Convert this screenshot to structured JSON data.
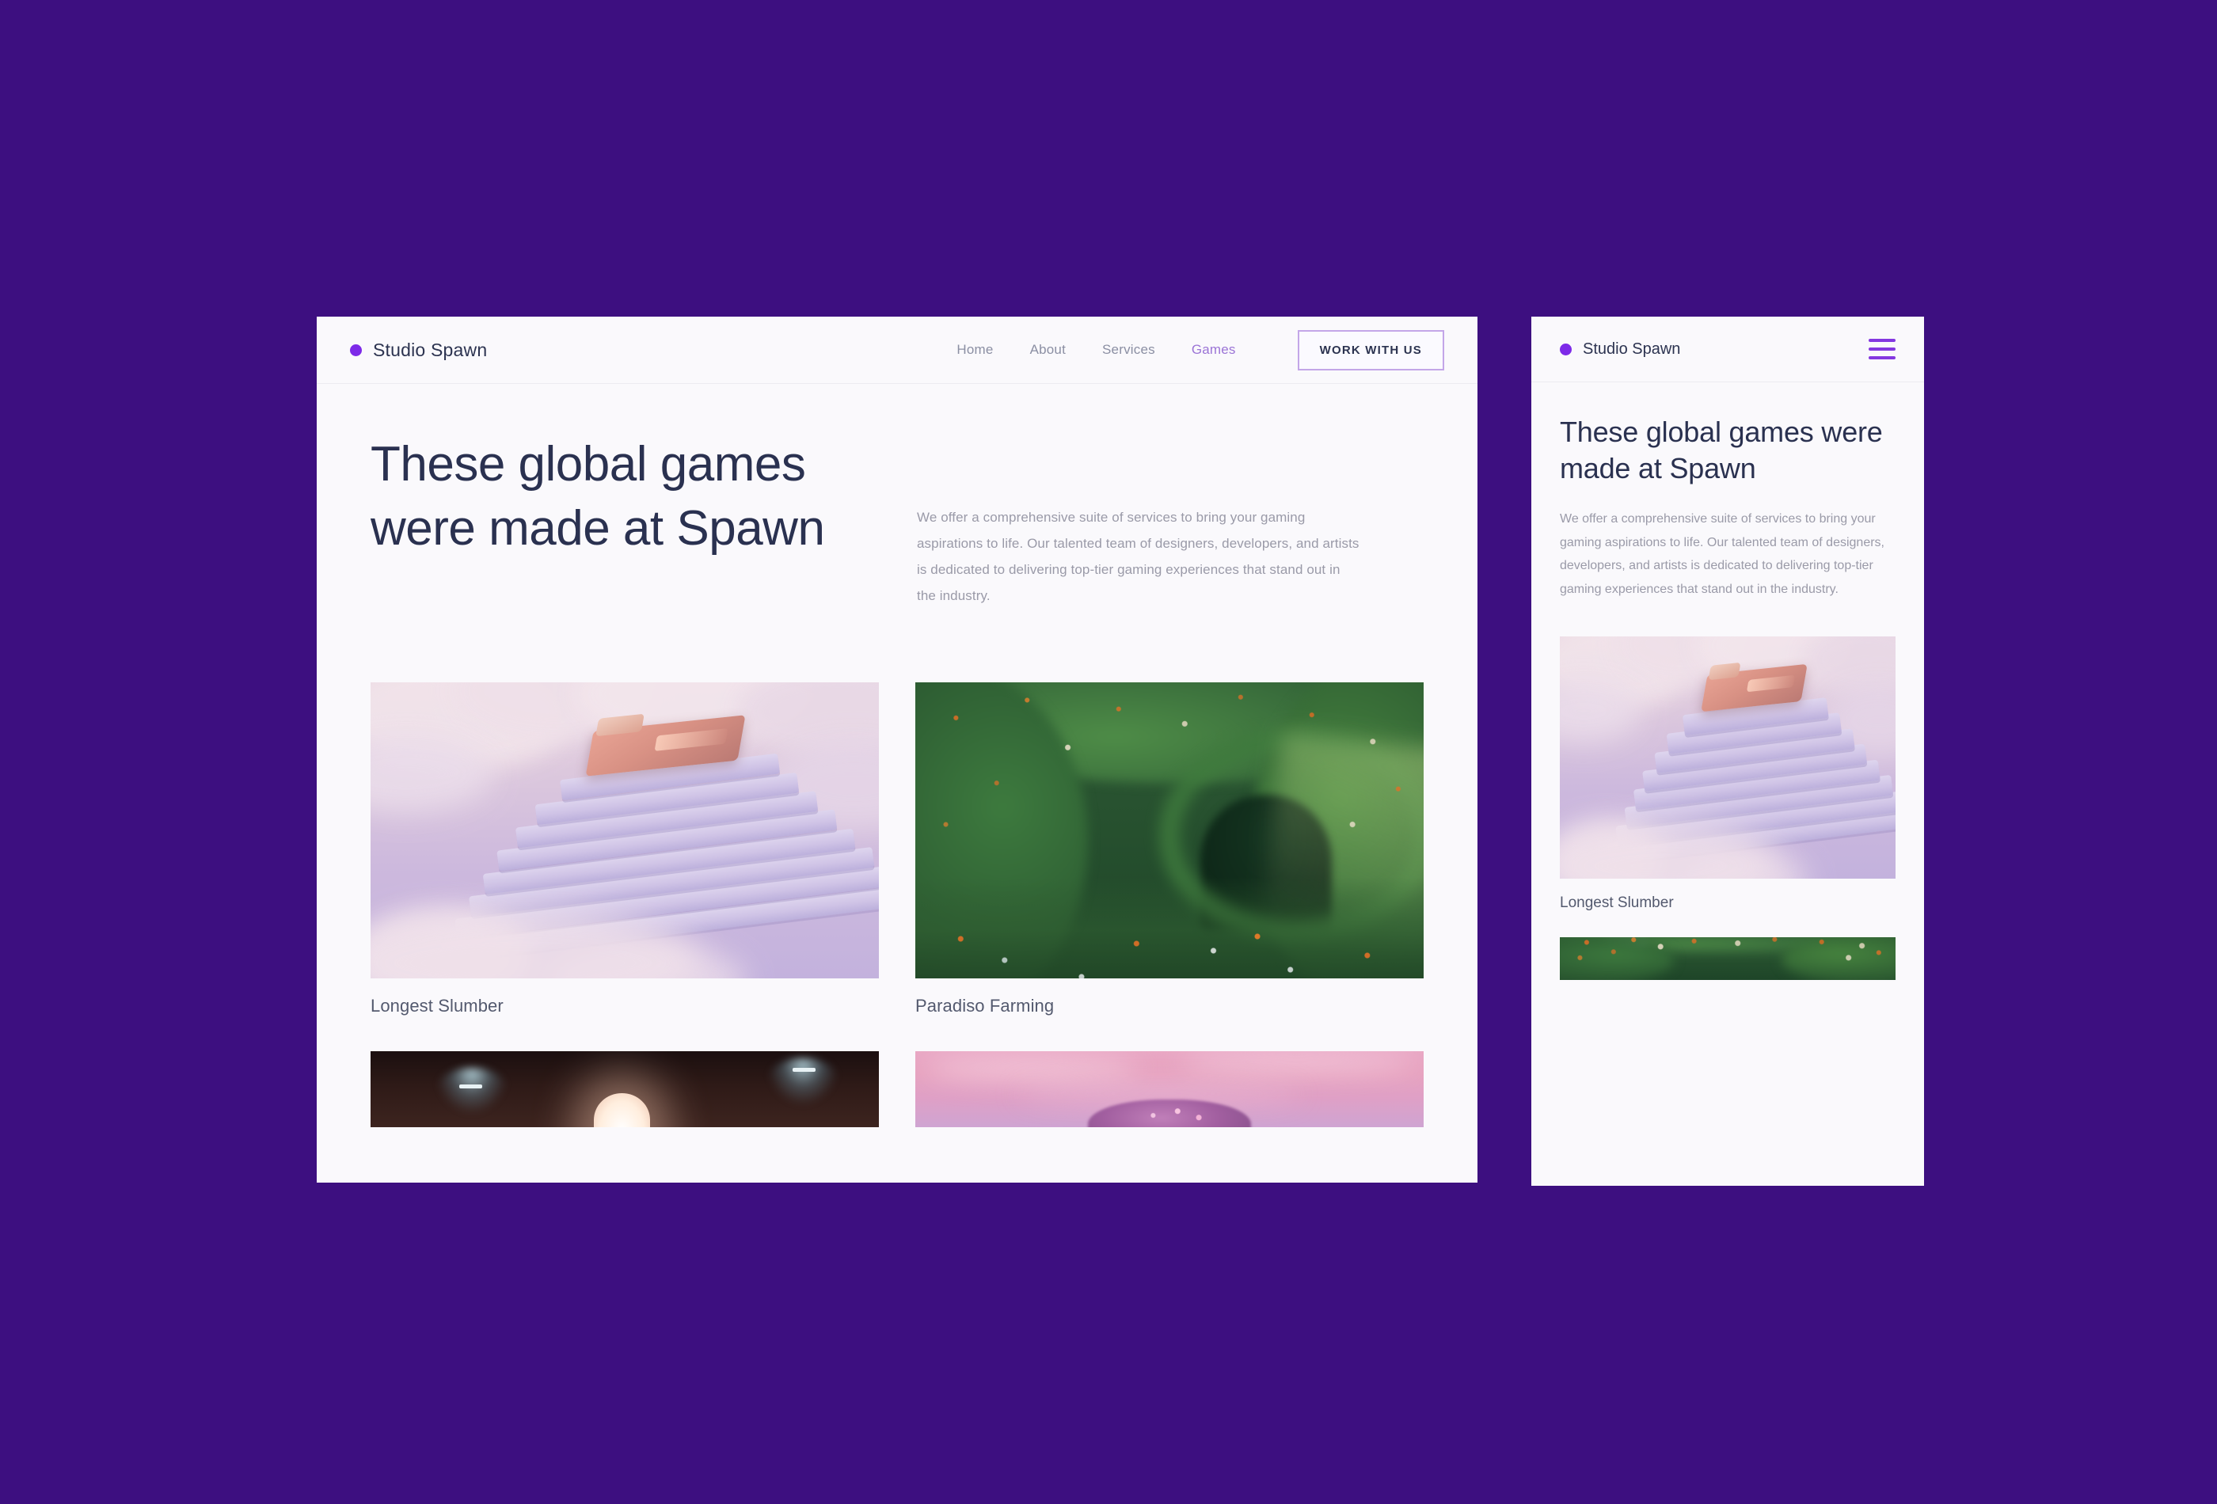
{
  "background_color": "#3d0f80",
  "brand": {
    "name": "Studio Spawn",
    "dot_color": "#7d2ae8"
  },
  "desktop": {
    "nav": [
      {
        "label": "Home",
        "active": false
      },
      {
        "label": "About",
        "active": false
      },
      {
        "label": "Services",
        "active": false
      },
      {
        "label": "Games",
        "active": true
      }
    ],
    "cta_label": "WORK WITH US",
    "cta_border_color": "#c3a6e8",
    "heading": "These global games were made at Spawn",
    "paragraph": "We offer a comprehensive suite of services to bring your gaming aspirations to life. Our talented team of designers, developers, and artists is dedicated to delivering top-tier gaming experiences that stand out in the industry.",
    "cards": [
      {
        "title": "Longest Slumber",
        "art": "art-slumber"
      },
      {
        "title": "Paradiso Farming",
        "art": "art-paradiso"
      },
      {
        "title": "",
        "art": "art-hall"
      },
      {
        "title": "",
        "art": "art-blossom"
      }
    ]
  },
  "mobile": {
    "menu_icon": "hamburger-icon",
    "menu_icon_color": "#8438e0",
    "heading": "These global games were made at Spawn",
    "paragraph": "We offer a comprehensive suite of services to bring your gaming aspirations to life. Our talented team of designers, developers, and artists is dedicated to delivering top-tier gaming experiences that stand out in the industry.",
    "cards": [
      {
        "title": "Longest Slumber",
        "art": "art-slumber"
      },
      {
        "title": "",
        "art": "art-paradiso"
      }
    ]
  }
}
